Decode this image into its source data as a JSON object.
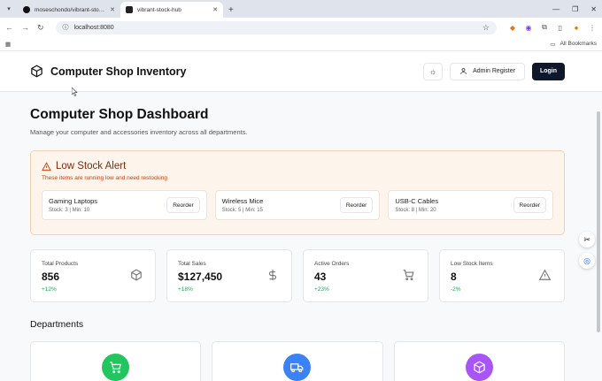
{
  "browser": {
    "tabs": [
      {
        "label": "moseschondo/vibrant-stock-h",
        "active": false
      },
      {
        "label": "vibrant-stock-hub",
        "active": true
      }
    ],
    "new_tab": "+",
    "url": "localhost:8080",
    "bookmarks_label": "All Bookmarks"
  },
  "app": {
    "title": "Computer Shop Inventory",
    "admin_register": "Admin Register",
    "login": "Login"
  },
  "page": {
    "title": "Computer Shop Dashboard",
    "subtitle": "Manage your computer and accessories inventory across all departments."
  },
  "alert": {
    "title": "Low Stock Alert",
    "subtitle": "These items are running low and need restocking",
    "items": [
      {
        "name": "Gaming Laptops",
        "meta": "Stock: 3 | Min: 10",
        "action": "Reorder"
      },
      {
        "name": "Wireless Mice",
        "meta": "Stock: 5 | Min: 15",
        "action": "Reorder"
      },
      {
        "name": "USB-C Cables",
        "meta": "Stock: 8 | Min: 20",
        "action": "Reorder"
      }
    ]
  },
  "stats": [
    {
      "label": "Total Products",
      "value": "856",
      "change": "+12%",
      "icon": "box-icon"
    },
    {
      "label": "Total Sales",
      "value": "$127,450",
      "change": "+18%",
      "icon": "dollar-icon"
    },
    {
      "label": "Active Orders",
      "value": "43",
      "change": "+23%",
      "icon": "cart-icon"
    },
    {
      "label": "Low Stock Items",
      "value": "8",
      "change": "-2%",
      "icon": "warning-icon"
    }
  ],
  "departments": {
    "title": "Departments",
    "items": [
      {
        "icon": "cart-icon",
        "color": "#22c55e"
      },
      {
        "icon": "truck-icon",
        "color": "#3b82f6"
      },
      {
        "icon": "box-icon",
        "color": "#a855f7"
      }
    ]
  }
}
